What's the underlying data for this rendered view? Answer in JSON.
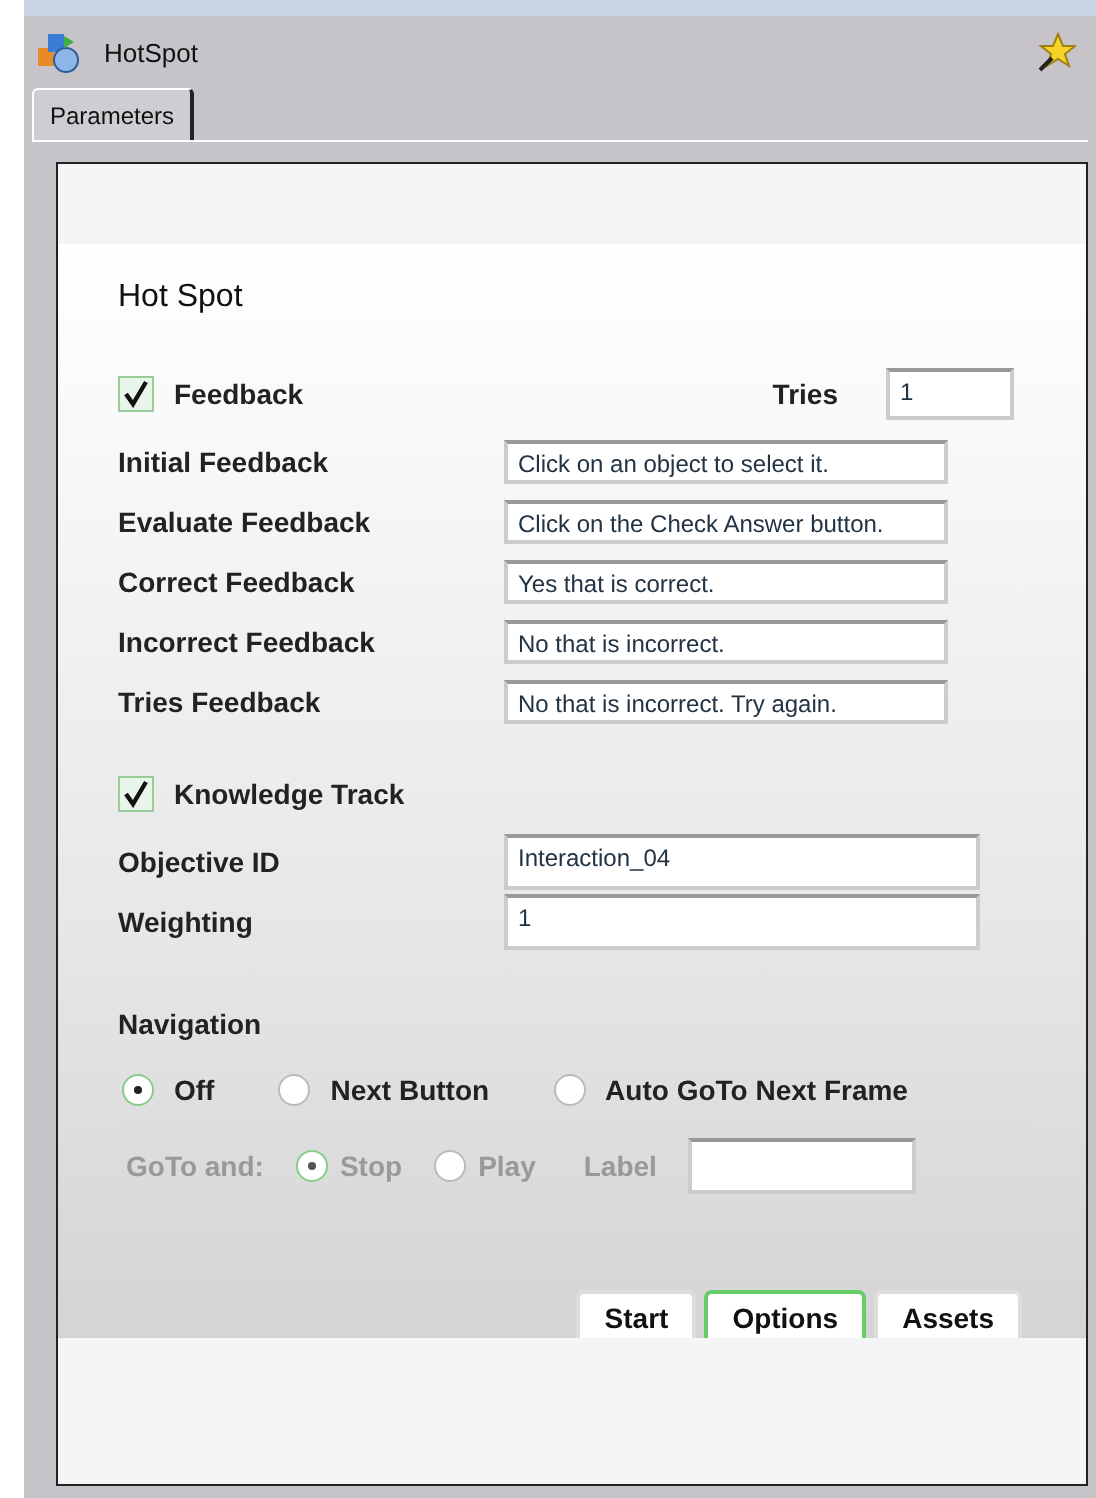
{
  "window": {
    "title": "HotSpot"
  },
  "tabs": [
    {
      "label": "Parameters",
      "selected": true
    }
  ],
  "panel": {
    "title": "Hot Spot",
    "feedback": {
      "label": "Feedback",
      "checked": true,
      "tries_label": "Tries",
      "tries_value": "1",
      "fields": [
        {
          "label": "Initial Feedback",
          "value": "Click on an object to select it."
        },
        {
          "label": "Evaluate Feedback",
          "value": "Click on the Check Answer button."
        },
        {
          "label": "Correct Feedback",
          "value": "Yes that is correct."
        },
        {
          "label": "Incorrect Feedback",
          "value": "No that is incorrect."
        },
        {
          "label": "Tries Feedback",
          "value": "No that is incorrect. Try again."
        }
      ]
    },
    "knowledge_track": {
      "label": "Knowledge Track",
      "checked": true,
      "fields": [
        {
          "label": "Objective ID",
          "value": "Interaction_04"
        },
        {
          "label": "Weighting",
          "value": "1"
        }
      ]
    },
    "navigation": {
      "label": "Navigation",
      "options": [
        {
          "label": "Off",
          "selected": true
        },
        {
          "label": "Next Button",
          "selected": false
        },
        {
          "label": "Auto GoTo Next Frame",
          "selected": false
        }
      ]
    },
    "goto": {
      "label": "GoTo and:",
      "disabled": true,
      "options": [
        {
          "label": "Stop",
          "selected": true
        },
        {
          "label": "Play",
          "selected": false
        }
      ],
      "label_field": "Label"
    }
  },
  "bottom_tabs": [
    {
      "label": "Start",
      "selected": false
    },
    {
      "label": "Options",
      "selected": true
    },
    {
      "label": "Assets",
      "selected": false
    }
  ]
}
